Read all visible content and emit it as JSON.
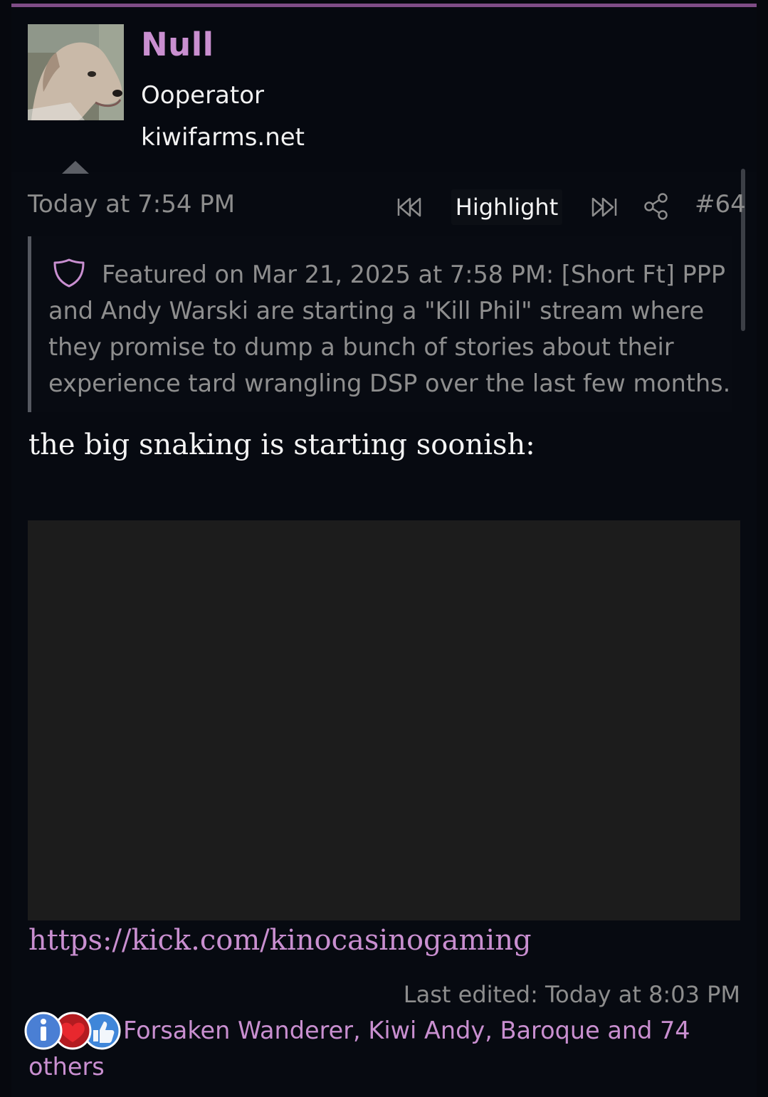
{
  "user": {
    "name": "Null",
    "title": "Ooperator",
    "site": "kiwifarms.net"
  },
  "post": {
    "timestamp": "Today at 7:54 PM",
    "highlight_label": "Highlight",
    "number": "#64",
    "featured_text": "Featured on Mar 21, 2025 at 7:58 PM: [Short Ft] PPP and Andy Warski are starting a \"Kill Phil\" stream where they promise to dump a bunch of stories about their experience tard wrangling DSP over the last few months.",
    "body": "the big snaking is starting soonish:",
    "link": "https://kick.com/kinocasinogaming",
    "last_edited": "Last edited: Today at 8:03 PM",
    "reactions_text": "Forsaken Wanderer, Kiwi Andy, Baroque and 74 others"
  },
  "icons": {
    "first": "rewind-icon",
    "next": "fast-forward-icon",
    "share": "share-icon",
    "featured": "shield-icon",
    "reactions": [
      "informative-icon",
      "heart-icon",
      "thumbs-up-icon"
    ]
  },
  "colors": {
    "accent": "#c98fd0",
    "muted": "#8d8d8d",
    "background": "#070a11",
    "embed": "#1c1c1c"
  }
}
